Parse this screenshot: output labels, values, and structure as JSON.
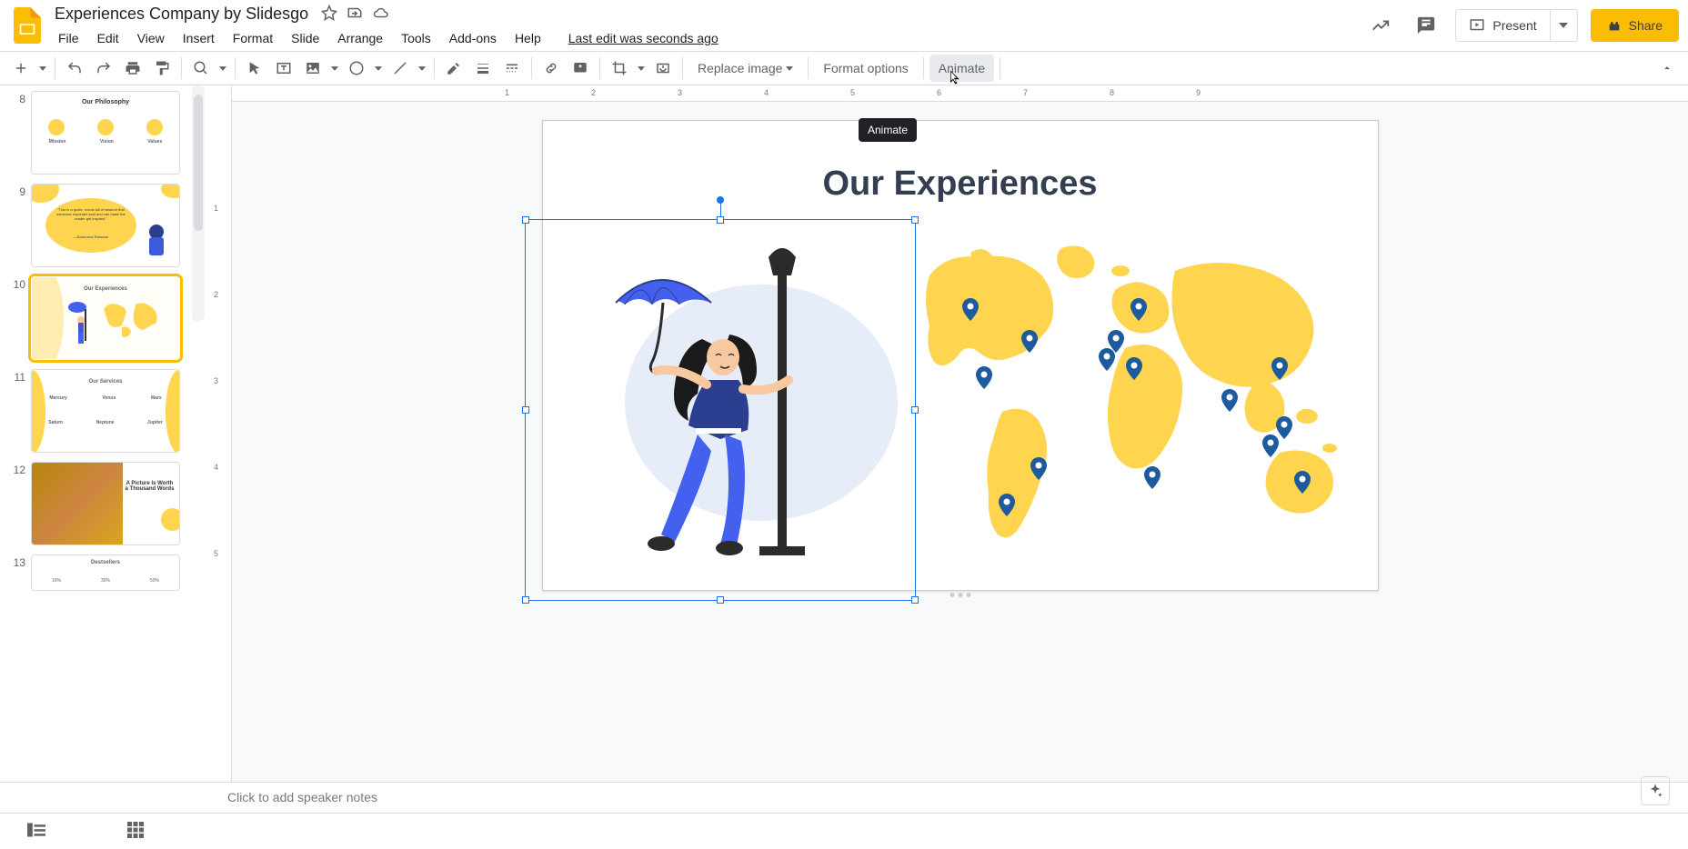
{
  "header": {
    "doc_title": "Experiences Company by Slidesgo",
    "last_edit": "Last edit was seconds ago"
  },
  "buttons": {
    "present": "Present",
    "share": "Share"
  },
  "menubar": [
    "File",
    "Edit",
    "View",
    "Insert",
    "Format",
    "Slide",
    "Arrange",
    "Tools",
    "Add-ons",
    "Help"
  ],
  "toolbar": {
    "replace_image": "Replace image",
    "format_options": "Format options",
    "animate": "Animate"
  },
  "tooltip": {
    "animate": "Animate"
  },
  "slide": {
    "title": "Our Experiences"
  },
  "thumbs": {
    "items": [
      {
        "num": "8",
        "title": "Our Philosophy",
        "sub1": "Mission",
        "sub2": "Vision",
        "sub3": "Values"
      },
      {
        "num": "9",
        "quote": "\"This is a quote, words full of wisdom that someone important said and can make the reader get inspired.\"",
        "author": "—Someone Famous"
      },
      {
        "num": "10",
        "title": "Our Experiences"
      },
      {
        "num": "11",
        "title": "Our Services",
        "row1": [
          "Mercury",
          "Venus",
          "Mars"
        ],
        "row2": [
          "Saturn",
          "Neptune",
          "Jupiter"
        ]
      },
      {
        "num": "12",
        "caption": "A Picture Is Worth a Thousand Words"
      },
      {
        "num": "13",
        "title": "Destsellers",
        "vals": [
          "10%",
          "30%",
          "50%"
        ]
      }
    ]
  },
  "notes": {
    "placeholder": "Click to add speaker notes"
  },
  "ruler_h": [
    "",
    "1",
    "2",
    "3",
    "4",
    "5",
    "6",
    "7",
    "8",
    "9"
  ],
  "ruler_v": [
    "",
    "1",
    "2",
    "3",
    "4",
    "5"
  ]
}
